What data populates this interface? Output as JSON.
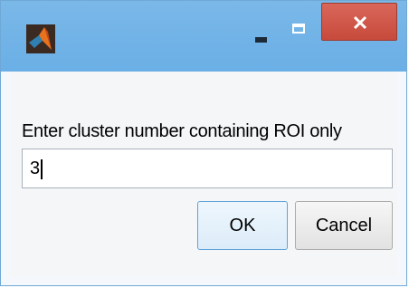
{
  "window": {
    "prompt_text": "Enter cluster number containing ROI only",
    "input_value": "3"
  },
  "titlebar": {
    "app_icon": "matlab-icon",
    "minimize_icon": "minimize-icon",
    "maximize_icon": "maximize-icon",
    "close_icon": "close-icon",
    "close_color": "#c74a3c",
    "titlebar_color": "#6aafe6"
  },
  "buttons": {
    "ok_label": "OK",
    "cancel_label": "Cancel"
  }
}
